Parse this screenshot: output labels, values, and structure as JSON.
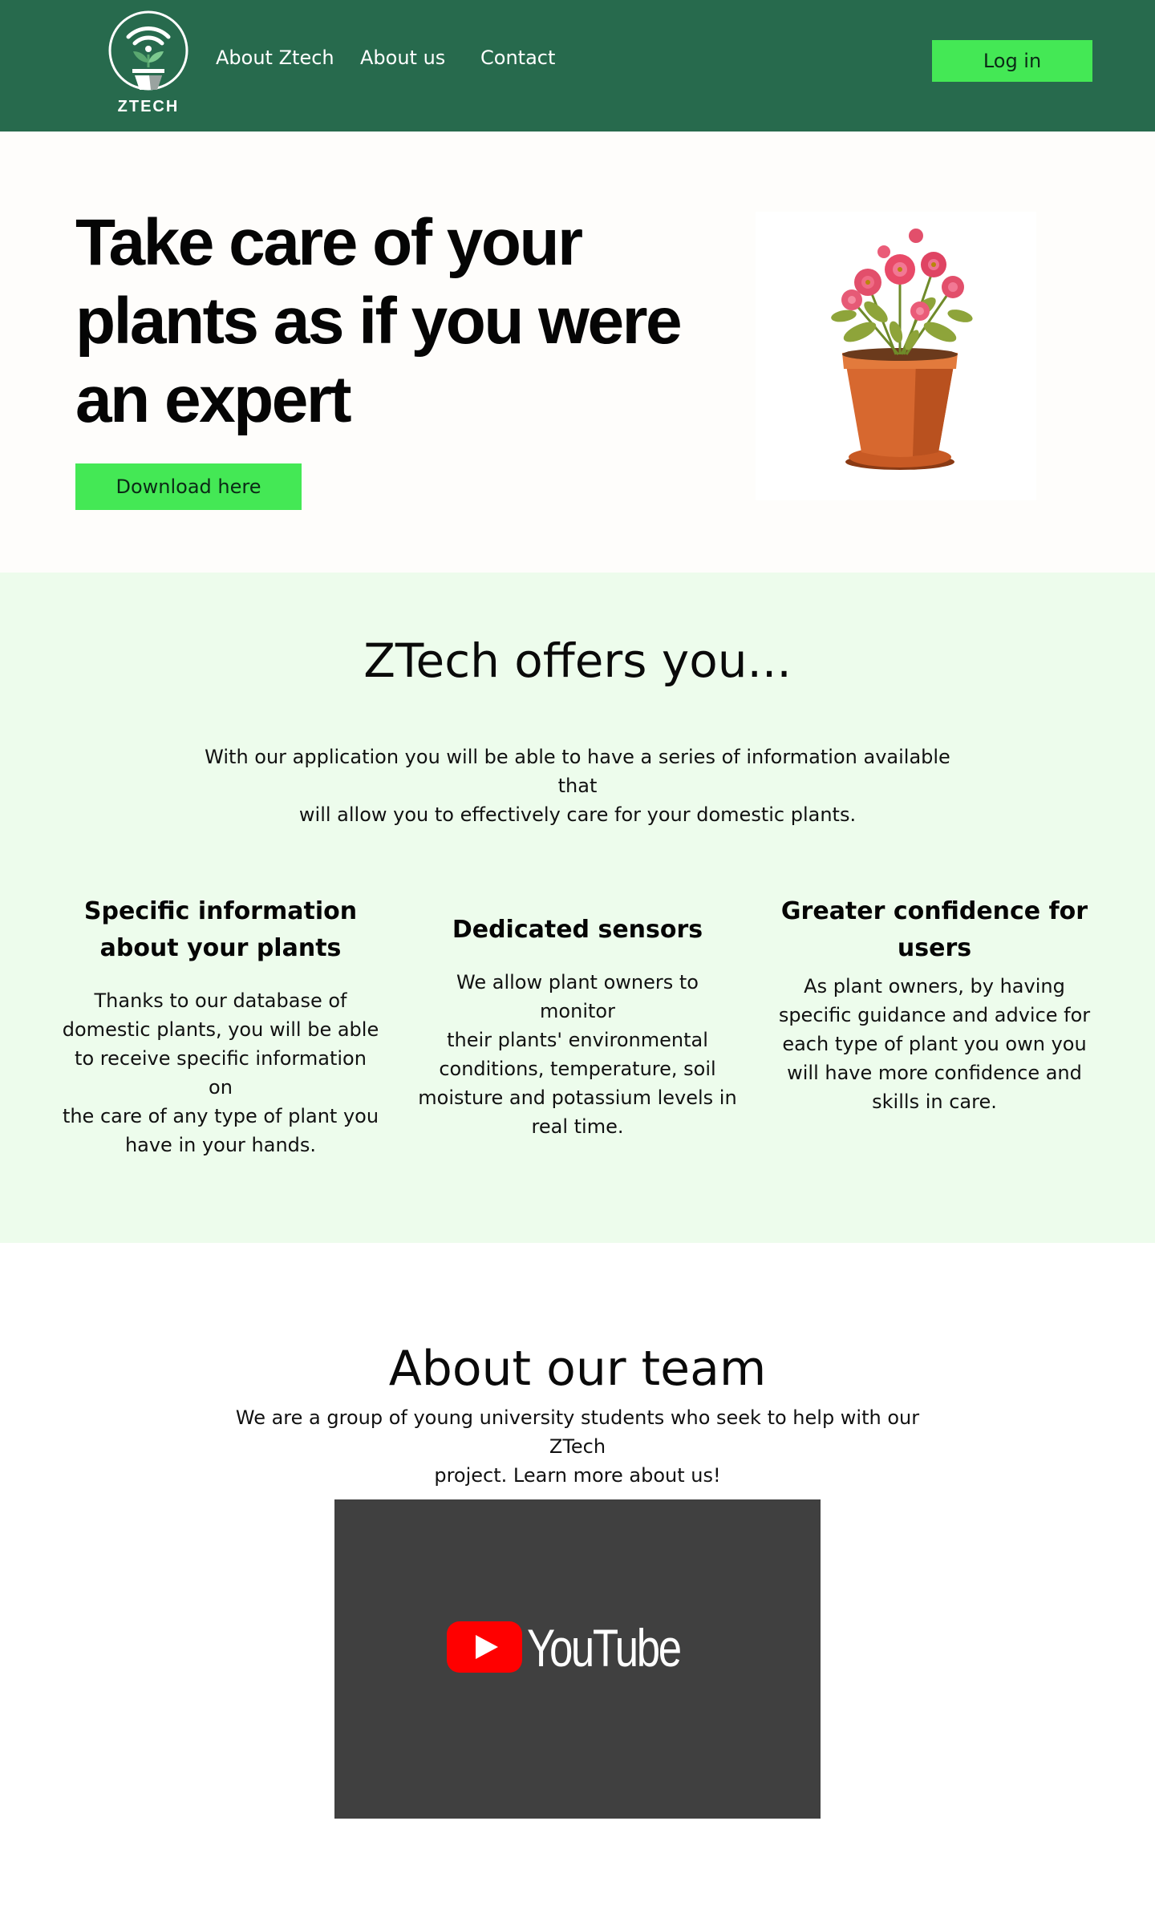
{
  "header": {
    "logo_text": "ZTECH",
    "nav": [
      "About Ztech",
      "About us",
      "Contact"
    ],
    "login_label": "Log in"
  },
  "hero": {
    "title_lines": [
      "Take care of your",
      "plants as if you were",
      "an expert"
    ],
    "download_label": "Download here",
    "image_icon": "potted-flower-plant"
  },
  "offers": {
    "title": "ZTech offers you...",
    "intro_lines": [
      "With our application you will be able to have a series of information available that",
      "will allow you to effectively care for your domestic plants."
    ],
    "features": [
      {
        "title_lines": [
          "Specific information",
          "about your plants"
        ],
        "text_lines": [
          "Thanks to our database of",
          "domestic plants, you will be able",
          "to receive specific information on",
          "the care of any type of plant you",
          "have in your hands."
        ]
      },
      {
        "title_lines": [
          "Dedicated sensors"
        ],
        "text_lines": [
          "We allow plant owners to monitor",
          "their plants' environmental",
          "conditions, temperature, soil",
          "moisture and potassium levels in",
          "real time."
        ]
      },
      {
        "title_lines": [
          "Greater confidence for",
          "users"
        ],
        "text_lines": [
          "As plant owners, by having",
          "specific guidance and advice for",
          "each type of plant you own you",
          "will have more confidence and",
          "skills in care."
        ]
      }
    ]
  },
  "team": {
    "title": "About our team",
    "text_lines": [
      "We are a group of young university students who seek to help with our ZTech",
      "project. Learn more about us!"
    ],
    "video_brand": "YouTube"
  },
  "colors": {
    "header_bg": "#276a4d",
    "accent_green": "#44e855",
    "offers_bg": "#edfcec",
    "video_bg": "#404040",
    "youtube_red": "#ff0000"
  }
}
